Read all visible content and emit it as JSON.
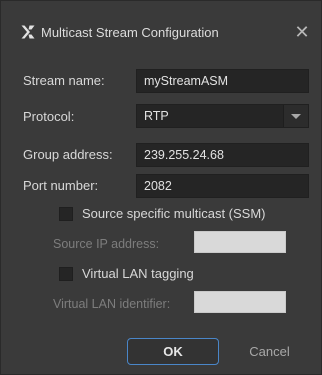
{
  "window": {
    "title": "Multicast Stream Configuration",
    "close_symbol": "✕"
  },
  "form": {
    "stream_name": {
      "label": "Stream name:",
      "value": "myStreamASM"
    },
    "protocol": {
      "label": "Protocol:",
      "value": "RTP"
    },
    "group_address": {
      "label": "Group address:",
      "value": "239.255.24.68"
    },
    "port_number": {
      "label": "Port number:",
      "value": "2082"
    },
    "ssm": {
      "label": "Source specific multicast (SSM)",
      "checked": false
    },
    "source_ip": {
      "label": "Source IP address:",
      "value": "",
      "enabled": false
    },
    "vlan_tagging": {
      "label": "Virtual LAN tagging",
      "checked": false
    },
    "vlan_id": {
      "label": "Virtual LAN identifier:",
      "value": "",
      "enabled": false
    }
  },
  "buttons": {
    "ok": "OK",
    "cancel": "Cancel"
  },
  "icons": {
    "app": "x-logo-icon",
    "close": "close-icon",
    "dropdown": "chevron-down-icon"
  },
  "colors": {
    "background": "#3a3a3a",
    "field": "#252525",
    "accent_border": "#4a86c8",
    "disabled_field": "#d9d9d9"
  }
}
